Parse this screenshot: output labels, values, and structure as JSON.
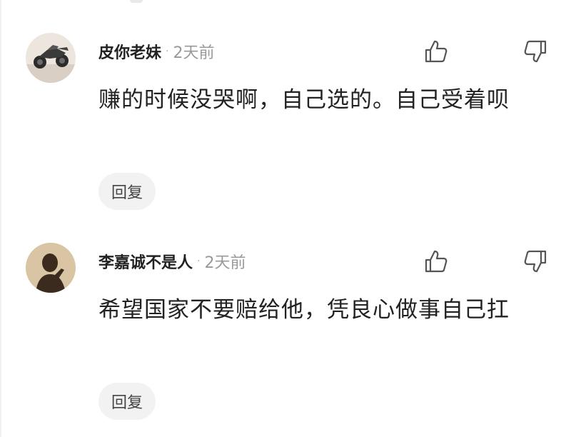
{
  "comments": [
    {
      "username": "皮你老妹",
      "separator": "·",
      "time": "2天前",
      "text": "赚的时候没哭啊，自己选的。自己受着呗",
      "reply_label": "回复",
      "like_icon": "thumbs-up-icon",
      "dislike_icon": "thumbs-down-icon",
      "avatar": "avatar-motorcycle"
    },
    {
      "username": "李嘉诚不是人",
      "separator": "·",
      "time": "2天前",
      "text": "希望国家不要赔给他，凭良心做事自己扛",
      "reply_label": "回复",
      "like_icon": "thumbs-up-icon",
      "dislike_icon": "thumbs-down-icon",
      "avatar": "avatar-silhouette"
    }
  ],
  "colors": {
    "username": "#222222",
    "time": "#999999",
    "text": "#222222",
    "reply_bg": "#f2f2f2",
    "icon": "#555555"
  }
}
